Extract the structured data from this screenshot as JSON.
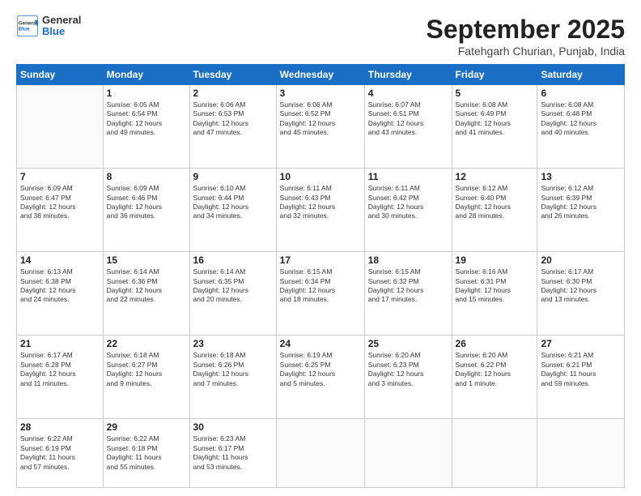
{
  "header": {
    "logo": {
      "general": "General",
      "blue": "Blue"
    },
    "title": "September 2025",
    "location": "Fatehgarh Churian, Punjab, India"
  },
  "weekdays": [
    "Sunday",
    "Monday",
    "Tuesday",
    "Wednesday",
    "Thursday",
    "Friday",
    "Saturday"
  ],
  "weeks": [
    [
      {
        "day": "",
        "info": ""
      },
      {
        "day": "1",
        "info": "Sunrise: 6:05 AM\nSunset: 6:54 PM\nDaylight: 12 hours\nand 49 minutes."
      },
      {
        "day": "2",
        "info": "Sunrise: 6:06 AM\nSunset: 6:53 PM\nDaylight: 12 hours\nand 47 minutes."
      },
      {
        "day": "3",
        "info": "Sunrise: 6:06 AM\nSunset: 6:52 PM\nDaylight: 12 hours\nand 45 minutes."
      },
      {
        "day": "4",
        "info": "Sunrise: 6:07 AM\nSunset: 6:51 PM\nDaylight: 12 hours\nand 43 minutes."
      },
      {
        "day": "5",
        "info": "Sunrise: 6:08 AM\nSunset: 6:49 PM\nDaylight: 12 hours\nand 41 minutes."
      },
      {
        "day": "6",
        "info": "Sunrise: 6:08 AM\nSunset: 6:48 PM\nDaylight: 12 hours\nand 40 minutes."
      }
    ],
    [
      {
        "day": "7",
        "info": "Sunrise: 6:09 AM\nSunset: 6:47 PM\nDaylight: 12 hours\nand 38 minutes."
      },
      {
        "day": "8",
        "info": "Sunrise: 6:09 AM\nSunset: 6:46 PM\nDaylight: 12 hours\nand 36 minutes."
      },
      {
        "day": "9",
        "info": "Sunrise: 6:10 AM\nSunset: 6:44 PM\nDaylight: 12 hours\nand 34 minutes."
      },
      {
        "day": "10",
        "info": "Sunrise: 6:11 AM\nSunset: 6:43 PM\nDaylight: 12 hours\nand 32 minutes."
      },
      {
        "day": "11",
        "info": "Sunrise: 6:11 AM\nSunset: 6:42 PM\nDaylight: 12 hours\nand 30 minutes."
      },
      {
        "day": "12",
        "info": "Sunrise: 6:12 AM\nSunset: 6:40 PM\nDaylight: 12 hours\nand 28 minutes."
      },
      {
        "day": "13",
        "info": "Sunrise: 6:12 AM\nSunset: 6:39 PM\nDaylight: 12 hours\nand 26 minutes."
      }
    ],
    [
      {
        "day": "14",
        "info": "Sunrise: 6:13 AM\nSunset: 6:38 PM\nDaylight: 12 hours\nand 24 minutes."
      },
      {
        "day": "15",
        "info": "Sunrise: 6:14 AM\nSunset: 6:36 PM\nDaylight: 12 hours\nand 22 minutes."
      },
      {
        "day": "16",
        "info": "Sunrise: 6:14 AM\nSunset: 6:35 PM\nDaylight: 12 hours\nand 20 minutes."
      },
      {
        "day": "17",
        "info": "Sunrise: 6:15 AM\nSunset: 6:34 PM\nDaylight: 12 hours\nand 18 minutes."
      },
      {
        "day": "18",
        "info": "Sunrise: 6:15 AM\nSunset: 6:32 PM\nDaylight: 12 hours\nand 17 minutes."
      },
      {
        "day": "19",
        "info": "Sunrise: 6:16 AM\nSunset: 6:31 PM\nDaylight: 12 hours\nand 15 minutes."
      },
      {
        "day": "20",
        "info": "Sunrise: 6:17 AM\nSunset: 6:30 PM\nDaylight: 12 hours\nand 13 minutes."
      }
    ],
    [
      {
        "day": "21",
        "info": "Sunrise: 6:17 AM\nSunset: 6:28 PM\nDaylight: 12 hours\nand 11 minutes."
      },
      {
        "day": "22",
        "info": "Sunrise: 6:18 AM\nSunset: 6:27 PM\nDaylight: 12 hours\nand 9 minutes."
      },
      {
        "day": "23",
        "info": "Sunrise: 6:18 AM\nSunset: 6:26 PM\nDaylight: 12 hours\nand 7 minutes."
      },
      {
        "day": "24",
        "info": "Sunrise: 6:19 AM\nSunset: 6:25 PM\nDaylight: 12 hours\nand 5 minutes."
      },
      {
        "day": "25",
        "info": "Sunrise: 6:20 AM\nSunset: 6:23 PM\nDaylight: 12 hours\nand 3 minutes."
      },
      {
        "day": "26",
        "info": "Sunrise: 6:20 AM\nSunset: 6:22 PM\nDaylight: 12 hours\nand 1 minute."
      },
      {
        "day": "27",
        "info": "Sunrise: 6:21 AM\nSunset: 6:21 PM\nDaylight: 11 hours\nand 59 minutes."
      }
    ],
    [
      {
        "day": "28",
        "info": "Sunrise: 6:22 AM\nSunset: 6:19 PM\nDaylight: 11 hours\nand 57 minutes."
      },
      {
        "day": "29",
        "info": "Sunrise: 6:22 AM\nSunset: 6:18 PM\nDaylight: 11 hours\nand 55 minutes."
      },
      {
        "day": "30",
        "info": "Sunrise: 6:23 AM\nSunset: 6:17 PM\nDaylight: 11 hours\nand 53 minutes."
      },
      {
        "day": "",
        "info": ""
      },
      {
        "day": "",
        "info": ""
      },
      {
        "day": "",
        "info": ""
      },
      {
        "day": "",
        "info": ""
      }
    ]
  ]
}
